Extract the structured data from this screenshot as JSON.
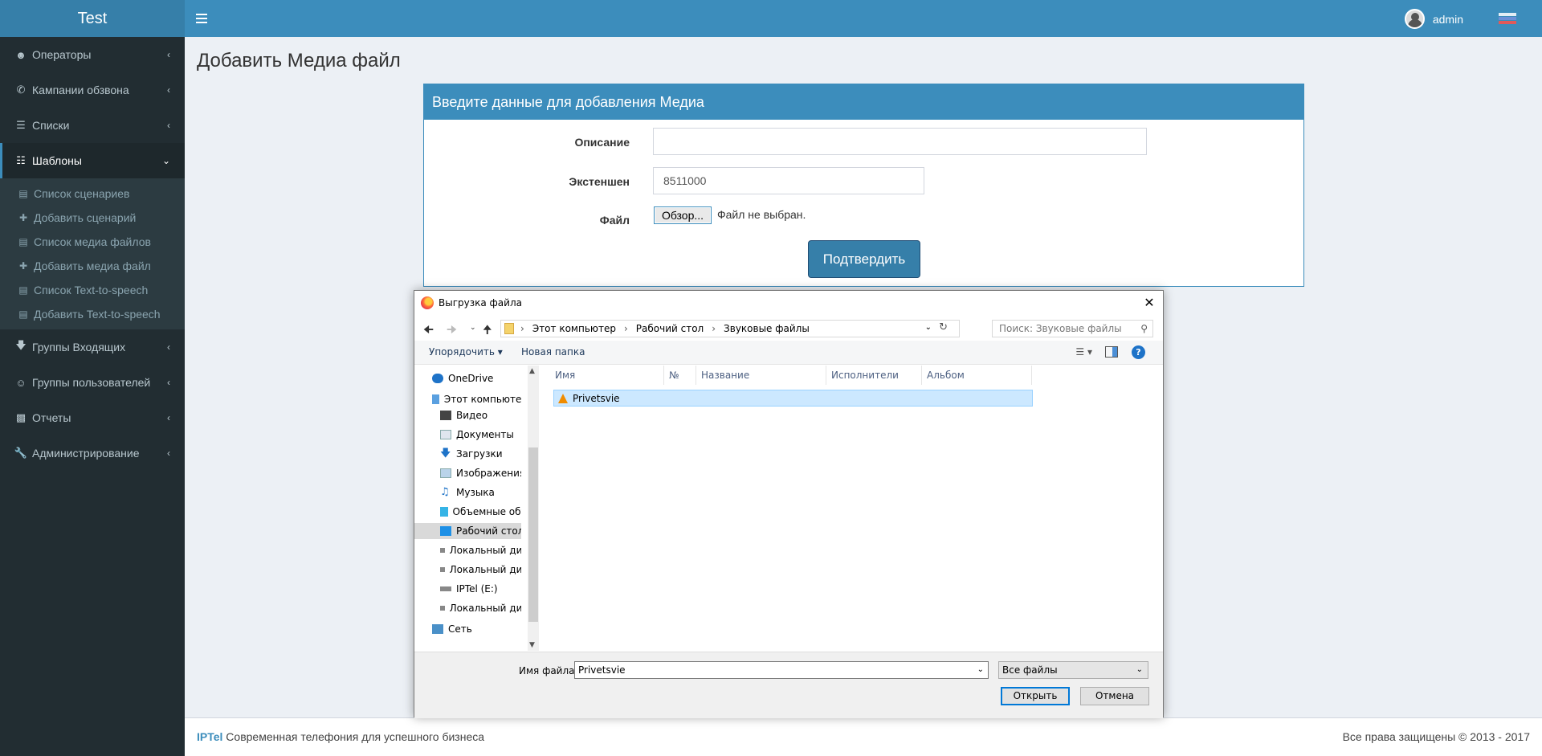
{
  "app": {
    "logo": "Test"
  },
  "header": {
    "username": "admin"
  },
  "sidebar": {
    "items": [
      {
        "label": "Операторы",
        "icon": "users-icon"
      },
      {
        "label": "Кампании обзвона",
        "icon": "phone-icon"
      },
      {
        "label": "Списки",
        "icon": "list-icon"
      },
      {
        "label": "Шаблоны",
        "icon": "template-icon"
      },
      {
        "label": "Группы Входящих",
        "icon": "arrow-down-icon"
      },
      {
        "label": "Группы пользователей",
        "icon": "user-circle-icon"
      },
      {
        "label": "Отчеты",
        "icon": "bar-chart-icon"
      },
      {
        "label": "Администрирование",
        "icon": "wrench-icon"
      }
    ],
    "subitems": [
      {
        "label": "Список сценариев",
        "icon": "table-icon"
      },
      {
        "label": "Добавить сценарий",
        "icon": "plus-icon"
      },
      {
        "label": "Список медиа файлов",
        "icon": "table-icon"
      },
      {
        "label": "Добавить медиа файл",
        "icon": "plus-icon"
      },
      {
        "label": "Список Text-to-speech",
        "icon": "table-icon"
      },
      {
        "label": "Добавить Text-to-speech",
        "icon": "table-icon"
      }
    ]
  },
  "main": {
    "page_title": "Добавить Медиа файл",
    "box_title": "Введите данные для добавления Медиа",
    "fields": {
      "description_label": "Описание",
      "description_value": "",
      "extension_label": "Экстеншен",
      "extension_value": "8511000",
      "file_label": "Файл",
      "file_button": "Обзор...",
      "file_status": "Файл не выбран."
    },
    "submit_label": "Подтвердить"
  },
  "footer": {
    "brand": "IPTel",
    "tagline": " Современная телефония для успешного бизнеса",
    "copyright": "Все права защищены © 2013 - 2017"
  },
  "dialog": {
    "title": "Выгрузка файла",
    "breadcrumb": [
      "Этот компьютер",
      "Рабочий стол",
      "Звуковые файлы"
    ],
    "search_placeholder": "Поиск: Звуковые файлы",
    "organize_label": "Упорядочить ▾",
    "new_folder_label": "Новая папка",
    "tree": [
      {
        "label": "OneDrive",
        "icon": "cloud-icon"
      },
      {
        "label": "Этот компьютер",
        "icon": "computer-icon"
      },
      {
        "label": "Видео",
        "icon": "video-icon"
      },
      {
        "label": "Документы",
        "icon": "document-icon"
      },
      {
        "label": "Загрузки",
        "icon": "download-icon"
      },
      {
        "label": "Изображения",
        "icon": "image-icon"
      },
      {
        "label": "Музыка",
        "icon": "music-icon"
      },
      {
        "label": "Объемные объ",
        "icon": "cube-icon"
      },
      {
        "label": "Рабочий стол",
        "icon": "desktop-icon"
      },
      {
        "label": "Локальный дис",
        "icon": "drive-icon"
      },
      {
        "label": "Локальный дис",
        "icon": "drive-icon"
      },
      {
        "label": "IPTel (E:)",
        "icon": "drive-icon"
      },
      {
        "label": "Локальный дис",
        "icon": "drive-icon"
      },
      {
        "label": "Сеть",
        "icon": "network-icon"
      }
    ],
    "columns": [
      "Имя",
      "№",
      "Название",
      "Исполнители",
      "Альбом"
    ],
    "files": [
      {
        "name": "Privetsvie",
        "icon": "vlc-icon"
      }
    ],
    "filename_label": "Имя файла:",
    "filename_value": "Privetsvie",
    "filter_value": "Все файлы",
    "open_label": "Открыть",
    "cancel_label": "Отмена"
  },
  "colors": {
    "primary": "#3c8dbc",
    "sidebar_bg": "#222d32",
    "content_bg": "#ecf0f5"
  }
}
